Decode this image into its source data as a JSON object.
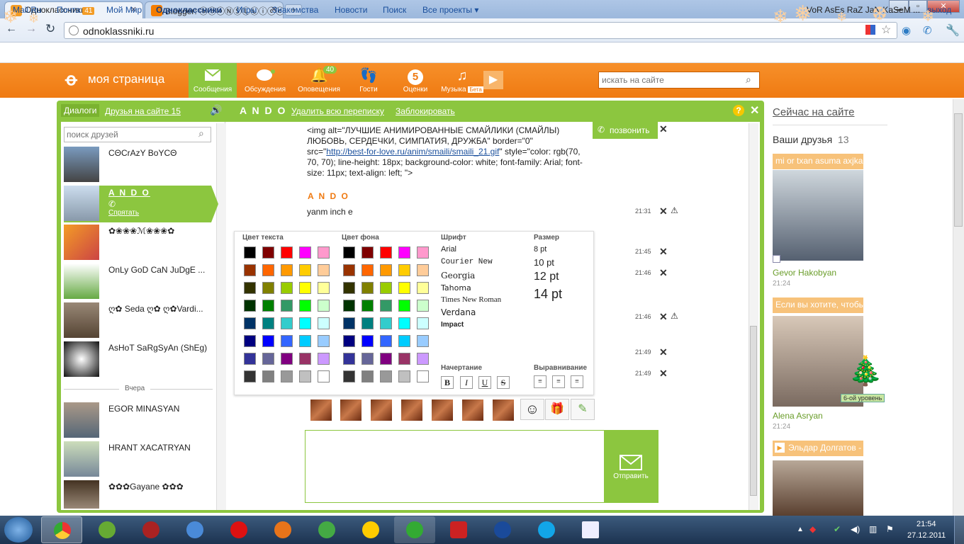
{
  "browser": {
    "tabs": [
      {
        "title": "Одноклассники"
      },
      {
        "title": "Blogger: ⓑⓑⓞⓃⓈⓁⓊⓘⓒⓞ"
      }
    ],
    "url": "odnoklassniki.ru"
  },
  "mailbar": {
    "links": [
      "Mail.Ru",
      "Почта",
      "Мой Мир",
      "Одноклассники",
      "Игры",
      "Знакомства",
      "Новости",
      "Поиск",
      "Все проекты ▾"
    ],
    "mail_count": "41",
    "user": "VoR AsEs RaZ JaN KaSeM ...",
    "logout": "выход"
  },
  "header": {
    "logo_text": "моя страница",
    "nav": [
      {
        "label": "Сообщения",
        "icon": "envelope-icon"
      },
      {
        "label": "Обсуждения",
        "icon": "speech-bubble-icon"
      },
      {
        "label": "Оповещения",
        "icon": "bell-icon",
        "badge": "40"
      },
      {
        "label": "Гости",
        "icon": "footprints-icon"
      },
      {
        "label": "Оценки",
        "icon": "five-rating-icon",
        "glyph": "5"
      },
      {
        "label": "Музыка",
        "icon": "music-note-icon",
        "beta": "Бета"
      }
    ],
    "search_placeholder": "искать на сайте"
  },
  "dialog": {
    "tab_dialogs": "Диалоги",
    "tab_online": "Друзья на сайте 15",
    "contact_name": "A N D O",
    "delete_all": "Удалить всю переписку",
    "block": "Заблокировать",
    "friend_search_placeholder": "поиск друзей",
    "friends": [
      {
        "name": "CΘCrAzY BoYCΘ"
      },
      {
        "name": "A N D O",
        "sub": "Спрятать"
      },
      {
        "name": "✿❀❀❀ℳ❀❀❀✿"
      },
      {
        "name": "OnLy GoD CaN JuDgE ..."
      },
      {
        "name": "ღ✿ Seda ღ✿   ღ✿Vardi..."
      },
      {
        "name": "AsHoT SaRgSyAn (ShEg)"
      }
    ],
    "yesterday_label": "Вчера",
    "friends_yesterday": [
      {
        "name": "EGOR MINASYAN"
      },
      {
        "name": "HRANT XACATRYAN"
      },
      {
        "name": "✿✿✿Gayane ✿✿✿"
      }
    ],
    "call_button": "позвонить",
    "message_html_text_pre": "<img alt=\"ЛУЧШИЕ АНИМИРОВАННЫЕ СМАЙЛИКИ (СМАЙЛЫ) ЛЮБОВЬ, СЕРДЕЧКИ, СИМПАТИЯ, ДРУЖБА\" border=\"0\" src=\"",
    "message_link": "http://best-for-love.ru/anim/smaili/smaili_21.gif",
    "message_html_text_post": "\" style=\"color: rgb(70, 70, 70); line-height: 18px; background-color: white; font-family: Arial; font-size: 11px; text-align: left; \">",
    "sender": "A N D O",
    "message": "yanm inch e",
    "times": [
      "21:31",
      "21:45",
      "21:46",
      "21:46",
      "21:49",
      "21:49"
    ],
    "send_label": "Отправить"
  },
  "format_panel": {
    "text_color_label": "Цвет текста",
    "bg_color_label": "Цвет фона",
    "font_label": "Шрифт",
    "size_label": "Размер",
    "fonts": [
      "Arial",
      "Courier New",
      "Georgia",
      "Tahoma",
      "Times New Roman",
      "Verdana",
      "Impact"
    ],
    "sizes": [
      "8 pt",
      "10 pt",
      "12 pt",
      "14 pt"
    ],
    "style_label": "Начертание",
    "align_label": "Выравнивание",
    "style_buttons": [
      "B",
      "I",
      "U",
      "S"
    ],
    "palette": [
      [
        "#000000",
        "#7f0000",
        "#ff0000",
        "#ff00ff",
        "#ff99cc"
      ],
      [
        "#993300",
        "#ff6600",
        "#ff9900",
        "#ffcc00",
        "#ffcc99"
      ],
      [
        "#333300",
        "#808000",
        "#99cc00",
        "#ffff00",
        "#ffff99"
      ],
      [
        "#003300",
        "#008000",
        "#339966",
        "#00ff00",
        "#ccffcc"
      ],
      [
        "#003366",
        "#008080",
        "#33cccc",
        "#00ffff",
        "#ccffff"
      ],
      [
        "#000080",
        "#0000ff",
        "#3366ff",
        "#00ccff",
        "#99ccff"
      ],
      [
        "#333399",
        "#666699",
        "#800080",
        "#993366",
        "#cc99ff"
      ],
      [
        "#333333",
        "#808080",
        "#999999",
        "#c0c0c0",
        "#ffffff"
      ]
    ]
  },
  "right": {
    "online_title": "Сейчас на сайте",
    "friends_label": "Ваши друзья",
    "friends_count": "13",
    "cards": [
      {
        "caption": "mi or txan asuma axjka",
        "name": "Gevor Hakobyan",
        "time": "21:24"
      },
      {
        "caption": "Если вы хотите, чтобы",
        "name": "Alena Asryan",
        "time": "21:24",
        "level": "6-ой уровень"
      },
      {
        "caption": "Эльдар Долгатов -"
      }
    ]
  },
  "taskbar": {
    "time": "21:54",
    "date": "27.12.2011"
  },
  "colors": {
    "orange": "#ef7a12",
    "green": "#8cc63f",
    "link": "#1a4f9c"
  }
}
